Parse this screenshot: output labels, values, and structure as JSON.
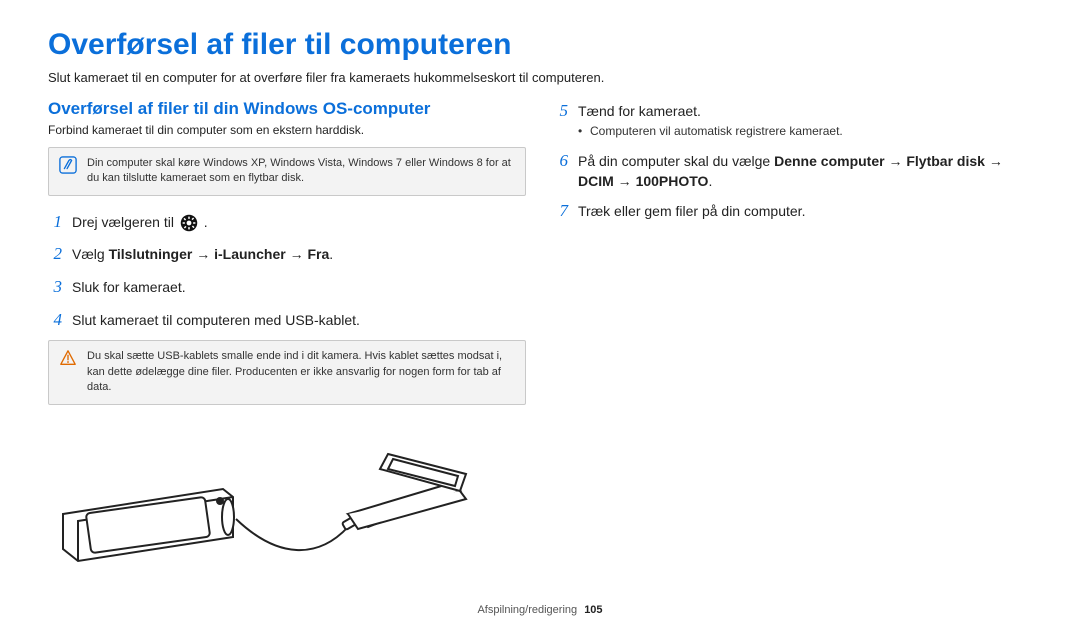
{
  "title": "Overførsel af filer til computeren",
  "intro": "Slut kameraet til en computer for at overføre filer fra kameraets hukommelseskort til computeren.",
  "left": {
    "heading": "Overførsel af filer til din Windows OS-computer",
    "sub": "Forbind kameraet til din computer som en ekstern harddisk.",
    "note1": "Din computer skal køre Windows XP, Windows Vista, Windows 7 eller Windows 8 for at du kan tilslutte kameraet som en flytbar disk.",
    "steps": {
      "s1_pre": "Drej vælgeren til ",
      "s1_post": ".",
      "s2_pre": "Vælg ",
      "s2_b1": "Tilslutninger",
      "s2_arr1": " → ",
      "s2_b2": "i-Launcher",
      "s2_arr2": " → ",
      "s2_b3": "Fra",
      "s2_post": ".",
      "s3": "Sluk for kameraet.",
      "s4": "Slut kameraet til computeren med USB-kablet."
    },
    "warn": "Du skal sætte USB-kablets smalle ende ind i dit kamera. Hvis kablet sættes modsat i, kan dette ødelægge dine filer. Producenten er ikke ansvarlig for nogen form for tab af data."
  },
  "right": {
    "steps": {
      "s5": "Tænd for kameraet.",
      "s5_bullet": "Computeren vil automatisk registrere kameraet.",
      "s6_pre": "På din computer skal du vælge ",
      "s6_b1": "Denne computer",
      "s6_arr1": " → ",
      "s6_b2": "Flytbar disk",
      "s6_arr2": " → ",
      "s6_b3": "DCIM",
      "s6_arr3": " → ",
      "s6_b4": "100PHOTO",
      "s6_post": ".",
      "s7": "Træk eller gem filer på din computer."
    }
  },
  "nums": {
    "n1": "1",
    "n2": "2",
    "n3": "3",
    "n4": "4",
    "n5": "5",
    "n6": "6",
    "n7": "7"
  },
  "footer": {
    "section": "Afspilning/redigering",
    "page": "105"
  }
}
